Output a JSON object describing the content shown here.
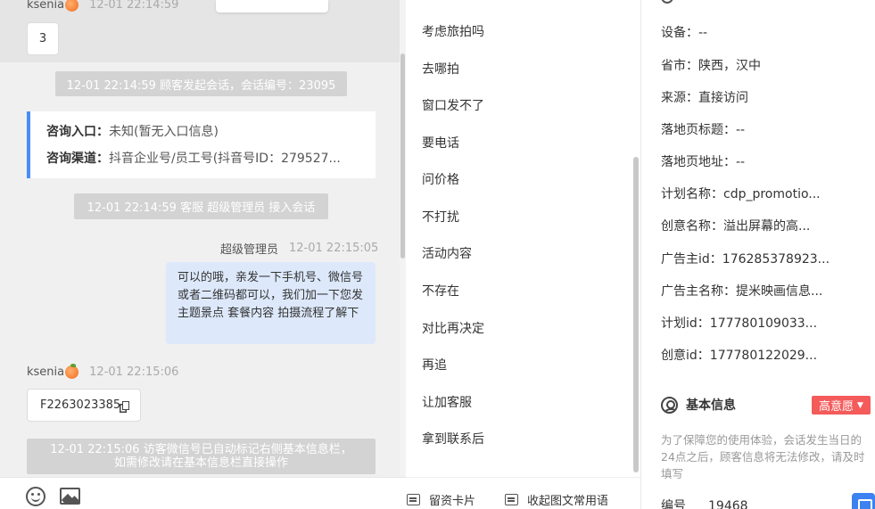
{
  "chat": {
    "msg1": {
      "sender": "ksenia",
      "time": "12-01 22:14:59",
      "text": "3"
    },
    "sys1": "12-01 22:14:59 顾客发起会话，会话编号：23095",
    "entry": {
      "label1": "咨询入口：",
      "value1": "未知(暂无入口信息)",
      "label2": "咨询渠道：",
      "value2": "抖音企业号/员工号(抖音号ID：279527..."
    },
    "sys2": "12-01 22:14:59 客服 超级管理员 接入会话",
    "agent": {
      "sender": "超级管理员",
      "time": "12-01 22:15:05",
      "text": "可以的哦，亲发一下手机号、微信号或者二维码都可以，我们加一下您发主题景点 套餐内容 拍摄流程了解下"
    },
    "msg2": {
      "sender": "ksenia",
      "time": "12-01 22:15:06",
      "text": "F2263023385"
    },
    "sys3": {
      "line1": "12-01 22:15:06 访客微信号已自动标记右侧基本信息栏，",
      "line2": "如需修改请在基本信息栏直接操作"
    }
  },
  "quick_replies": {
    "items": [
      "考虑旅拍吗",
      "去哪拍",
      "窗口发不了",
      "要电话",
      "问价格",
      "不打扰",
      "活动内容",
      "不存在",
      "对比再决定",
      "再追",
      "让加客服",
      "拿到联系后"
    ],
    "card_label": "留资卡片",
    "collapse_label": "收起图文常用语"
  },
  "visitor_info": {
    "fields": [
      {
        "label": "设备：",
        "value": "--"
      },
      {
        "label": "省市：",
        "value": "陕西，汉中"
      },
      {
        "label": "来源：",
        "value": "直接访问"
      },
      {
        "label": "落地页标题：",
        "value": "--"
      },
      {
        "label": "落地页地址：",
        "value": "--"
      },
      {
        "label": "计划名称：",
        "value": "cdp_promotio..."
      },
      {
        "label": "创意名称：",
        "value": "溢出屏幕的高..."
      },
      {
        "label": "广告主id：",
        "value": "176285378923..."
      },
      {
        "label": "广告主名称：",
        "value": "提米映画信息..."
      },
      {
        "label": "计划id：",
        "value": "177780109033..."
      },
      {
        "label": "创意id：",
        "value": "177780122029..."
      }
    ],
    "basic_title": "基本信息",
    "intent_label": "高意愿",
    "notice": "为了保障您的使用体验，会话发生当日的24点之后，顾客信息将无法修改，请及时填写",
    "id_label": "编号",
    "id_value": "19468"
  },
  "colors": {
    "accent": "#4a8cf7",
    "agent_bubble": "#dde9fb",
    "badge": "#f45b5b",
    "system_pill": "#d3d3d3"
  }
}
